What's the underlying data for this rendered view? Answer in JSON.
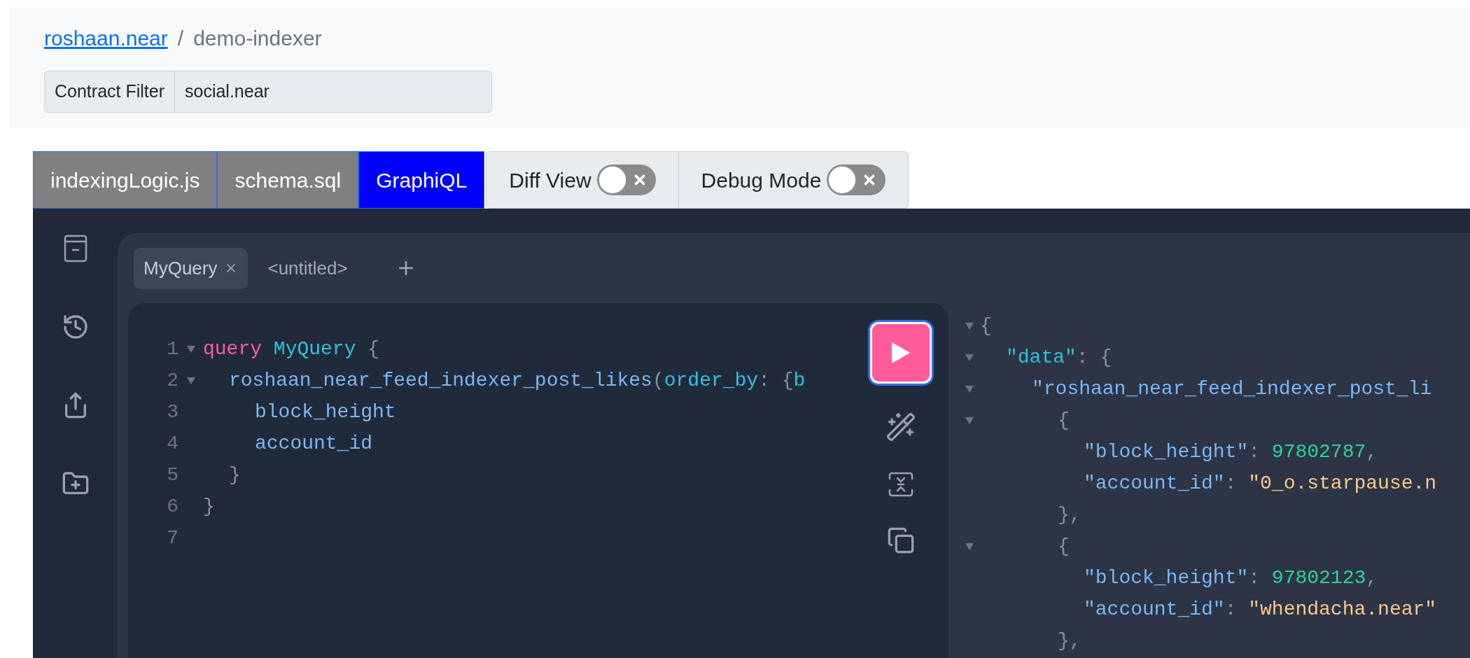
{
  "breadcrumb": {
    "account": "roshaan.near",
    "separator": "/",
    "indexer": "demo-indexer"
  },
  "contract_filter": {
    "label": "Contract Filter",
    "value": "social.near"
  },
  "tabs": [
    {
      "label": "indexingLogic.js",
      "selected": false
    },
    {
      "label": "schema.sql",
      "selected": false
    },
    {
      "label": "GraphiQL",
      "selected": true
    }
  ],
  "toggles": [
    {
      "label": "Diff View",
      "on": false
    },
    {
      "label": "Debug Mode",
      "on": false
    }
  ],
  "query_tabs": [
    {
      "label": "MyQuery",
      "selected": true,
      "closable": true
    },
    {
      "label": "<untitled>",
      "selected": false,
      "closable": false
    }
  ],
  "editor": {
    "lines": [
      {
        "number": "1",
        "tokens": [
          {
            "kind": "keyword",
            "text": "query "
          },
          {
            "kind": "name",
            "text": "MyQuery"
          },
          {
            "kind": "punct",
            "text": " {"
          }
        ],
        "children": [
          {
            "number": "2",
            "tokens": [
              {
                "kind": "field",
                "text": "roshaan_near_feed_indexer_post_likes"
              },
              {
                "kind": "punct",
                "text": "("
              },
              {
                "kind": "arg",
                "text": "order_by"
              },
              {
                "kind": "punct",
                "text": ": {"
              },
              {
                "kind": "arg",
                "text": "b"
              }
            ],
            "children": [
              {
                "number": "3",
                "tokens": [
                  {
                    "kind": "field",
                    "text": "block_height"
                  }
                ]
              },
              {
                "number": "4",
                "tokens": [
                  {
                    "kind": "field",
                    "text": "account_id"
                  }
                ]
              }
            ]
          },
          {
            "number": "5",
            "tokens": [
              {
                "kind": "punct",
                "text": "}"
              }
            ]
          }
        ]
      },
      {
        "number": "6",
        "tokens": [
          {
            "kind": "punct",
            "text": "}"
          }
        ]
      },
      {
        "number": "7"
      }
    ]
  },
  "results": {
    "lines": [
      {
        "tokens": [
          {
            "kind": "punct",
            "text": "{"
          }
        ],
        "children": [
          {
            "tokens": [
              {
                "kind": "name",
                "text": "\"data\""
              },
              {
                "kind": "punct",
                "text": ": {"
              }
            ],
            "children": [
              {
                "tokens": [
                  {
                    "kind": "field",
                    "text": "\"roshaan_near_feed_indexer_post_li"
                  }
                ],
                "children": [
                  {
                    "tokens": [
                      {
                        "kind": "punct",
                        "text": "{"
                      }
                    ],
                    "children": [
                      {
                        "tokens": [
                          {
                            "kind": "field",
                            "text": "\"block_height\""
                          },
                          {
                            "kind": "punct",
                            "text": ": "
                          },
                          {
                            "kind": "number",
                            "text": "97802787"
                          },
                          {
                            "kind": "punct",
                            "text": ","
                          }
                        ]
                      },
                      {
                        "tokens": [
                          {
                            "kind": "field",
                            "text": "\"account_id\""
                          },
                          {
                            "kind": "punct",
                            "text": ": "
                          },
                          {
                            "kind": "string",
                            "text": "\"0_o.starpause.n"
                          }
                        ]
                      }
                    ]
                  },
                  {
                    "tokens": [
                      {
                        "kind": "punct",
                        "text": "},"
                      }
                    ]
                  },
                  {
                    "tokens": [
                      {
                        "kind": "punct",
                        "text": "{"
                      }
                    ],
                    "children": [
                      {
                        "tokens": [
                          {
                            "kind": "field",
                            "text": "\"block_height\""
                          },
                          {
                            "kind": "punct",
                            "text": ": "
                          },
                          {
                            "kind": "number",
                            "text": "97802123"
                          },
                          {
                            "kind": "punct",
                            "text": ","
                          }
                        ]
                      },
                      {
                        "tokens": [
                          {
                            "kind": "field",
                            "text": "\"account_id\""
                          },
                          {
                            "kind": "punct",
                            "text": ": "
                          },
                          {
                            "kind": "string",
                            "text": "\"whendacha.near\""
                          }
                        ]
                      }
                    ]
                  },
                  {
                    "tokens": [
                      {
                        "kind": "punct",
                        "text": "},"
                      }
                    ]
                  }
                ]
              }
            ]
          }
        ]
      }
    ]
  }
}
